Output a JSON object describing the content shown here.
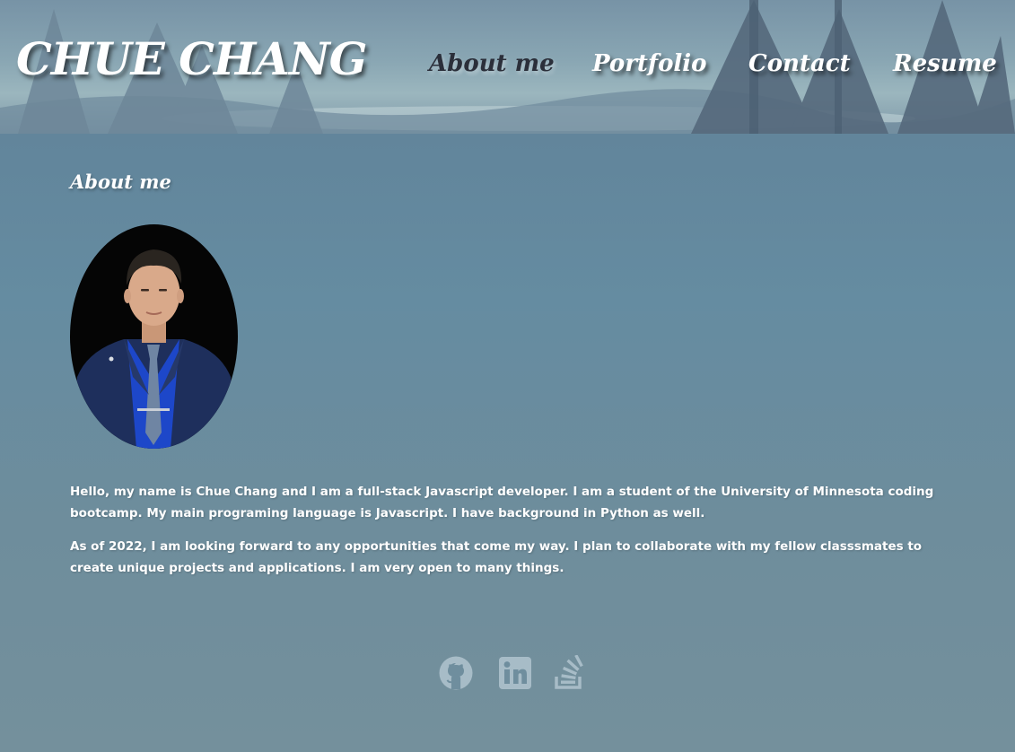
{
  "header": {
    "brand": "CHUE CHANG",
    "nav": [
      {
        "label": "About me",
        "active": true
      },
      {
        "label": "Portfolio",
        "active": false
      },
      {
        "label": "Contact",
        "active": false
      },
      {
        "label": "Resume",
        "active": false
      }
    ]
  },
  "about": {
    "title": "About me",
    "paragraphs": [
      "Hello, my name is Chue Chang and I am a full-stack Javascript developer. I am a student of the University of Minnesota coding bootcamp. My main programing language is Javascript. I have background in Python as well.",
      "As of 2022, I am looking forward to any opportunities that come my way. I plan to collaborate with my fellow classsmates to create unique projects and applications. I am very open to many things."
    ]
  },
  "socials": [
    {
      "icon": "github-icon"
    },
    {
      "icon": "linkedin-icon"
    },
    {
      "icon": "stack-overflow-icon"
    }
  ],
  "colors": {
    "page_background": "#658ca1",
    "header_sky": "#89a6b3",
    "text": "#ffffff",
    "nav_active": "#2b2f3a",
    "social_icon": "#a7bcc7"
  }
}
